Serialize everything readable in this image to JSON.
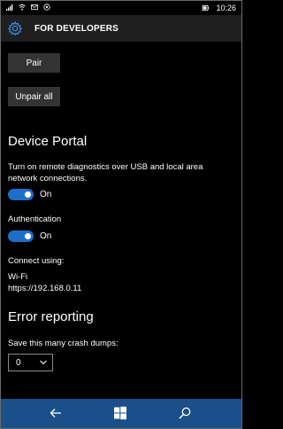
{
  "status_bar": {
    "time": "10:26",
    "icons": [
      "signal-icon",
      "wifi-icon",
      "envelope-icon",
      "location-icon"
    ],
    "right_icons": [
      "battery-icon"
    ]
  },
  "header": {
    "title": "FOR DEVELOPERS",
    "icon": "gear-icon"
  },
  "buttons": {
    "pair_label": "Pair",
    "unpair_label": "Unpair all"
  },
  "device_portal": {
    "title": "Device Portal",
    "description_line1": "Turn on remote diagnostics over USB and local area",
    "description_line2": "network connections.",
    "toggle_state": "On",
    "authentication_label": "Authentication",
    "authentication_state": "On",
    "connect_using_label": "Connect using:",
    "connection_type": "Wi-Fi",
    "connection_url": "https://192.168.0.11"
  },
  "error_reporting": {
    "title": "Error reporting",
    "crash_dumps_label": "Save this many crash dumps:",
    "crash_dumps_value": "0"
  },
  "nav_bar": {
    "icons": [
      "back-icon",
      "windows-start-icon",
      "search-icon"
    ]
  },
  "colors": {
    "accent": "#1e6ec8",
    "nav_bar": "#1b4f8a",
    "header": "#1f1f1f",
    "button": "#333333"
  }
}
